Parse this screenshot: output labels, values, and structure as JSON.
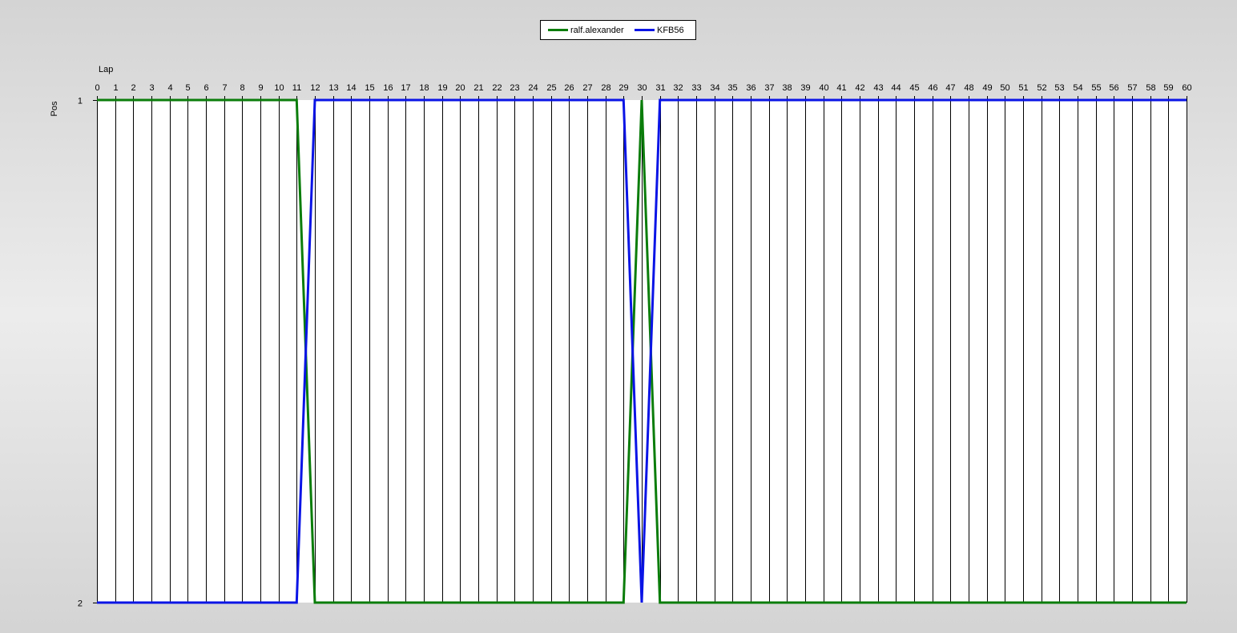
{
  "chart_data": {
    "type": "line",
    "xlabel": "Lap",
    "ylabel": "Pos",
    "x": [
      0,
      1,
      2,
      3,
      4,
      5,
      6,
      7,
      8,
      9,
      10,
      11,
      12,
      13,
      14,
      15,
      16,
      17,
      18,
      19,
      20,
      21,
      22,
      23,
      24,
      25,
      26,
      27,
      28,
      29,
      30,
      31,
      32,
      33,
      34,
      35,
      36,
      37,
      38,
      39,
      40,
      41,
      42,
      43,
      44,
      45,
      46,
      47,
      48,
      49,
      50,
      51,
      52,
      53,
      54,
      55,
      56,
      57,
      58,
      59,
      60
    ],
    "xlim": [
      0,
      60
    ],
    "ylim": [
      1,
      2
    ],
    "y_inverted": true,
    "y_ticks": [
      1,
      2
    ],
    "grid": "vertical",
    "legend_position": "top-center",
    "series": [
      {
        "name": "ralf.alexander",
        "color": "#0b7d0b",
        "values": [
          1,
          1,
          1,
          1,
          1,
          1,
          1,
          1,
          1,
          1,
          1,
          1,
          2,
          2,
          2,
          2,
          2,
          2,
          2,
          2,
          2,
          2,
          2,
          2,
          2,
          2,
          2,
          2,
          2,
          2,
          1,
          2,
          2,
          2,
          2,
          2,
          2,
          2,
          2,
          2,
          2,
          2,
          2,
          2,
          2,
          2,
          2,
          2,
          2,
          2,
          2,
          2,
          2,
          2,
          2,
          2,
          2,
          2,
          2,
          2,
          2
        ]
      },
      {
        "name": "KFB56",
        "color": "#0a14e6",
        "values": [
          2,
          2,
          2,
          2,
          2,
          2,
          2,
          2,
          2,
          2,
          2,
          2,
          1,
          1,
          1,
          1,
          1,
          1,
          1,
          1,
          1,
          1,
          1,
          1,
          1,
          1,
          1,
          1,
          1,
          1,
          2,
          1,
          1,
          1,
          1,
          1,
          1,
          1,
          1,
          1,
          1,
          1,
          1,
          1,
          1,
          1,
          1,
          1,
          1,
          1,
          1,
          1,
          1,
          1,
          1,
          1,
          1,
          1,
          1,
          1,
          1
        ]
      }
    ]
  }
}
